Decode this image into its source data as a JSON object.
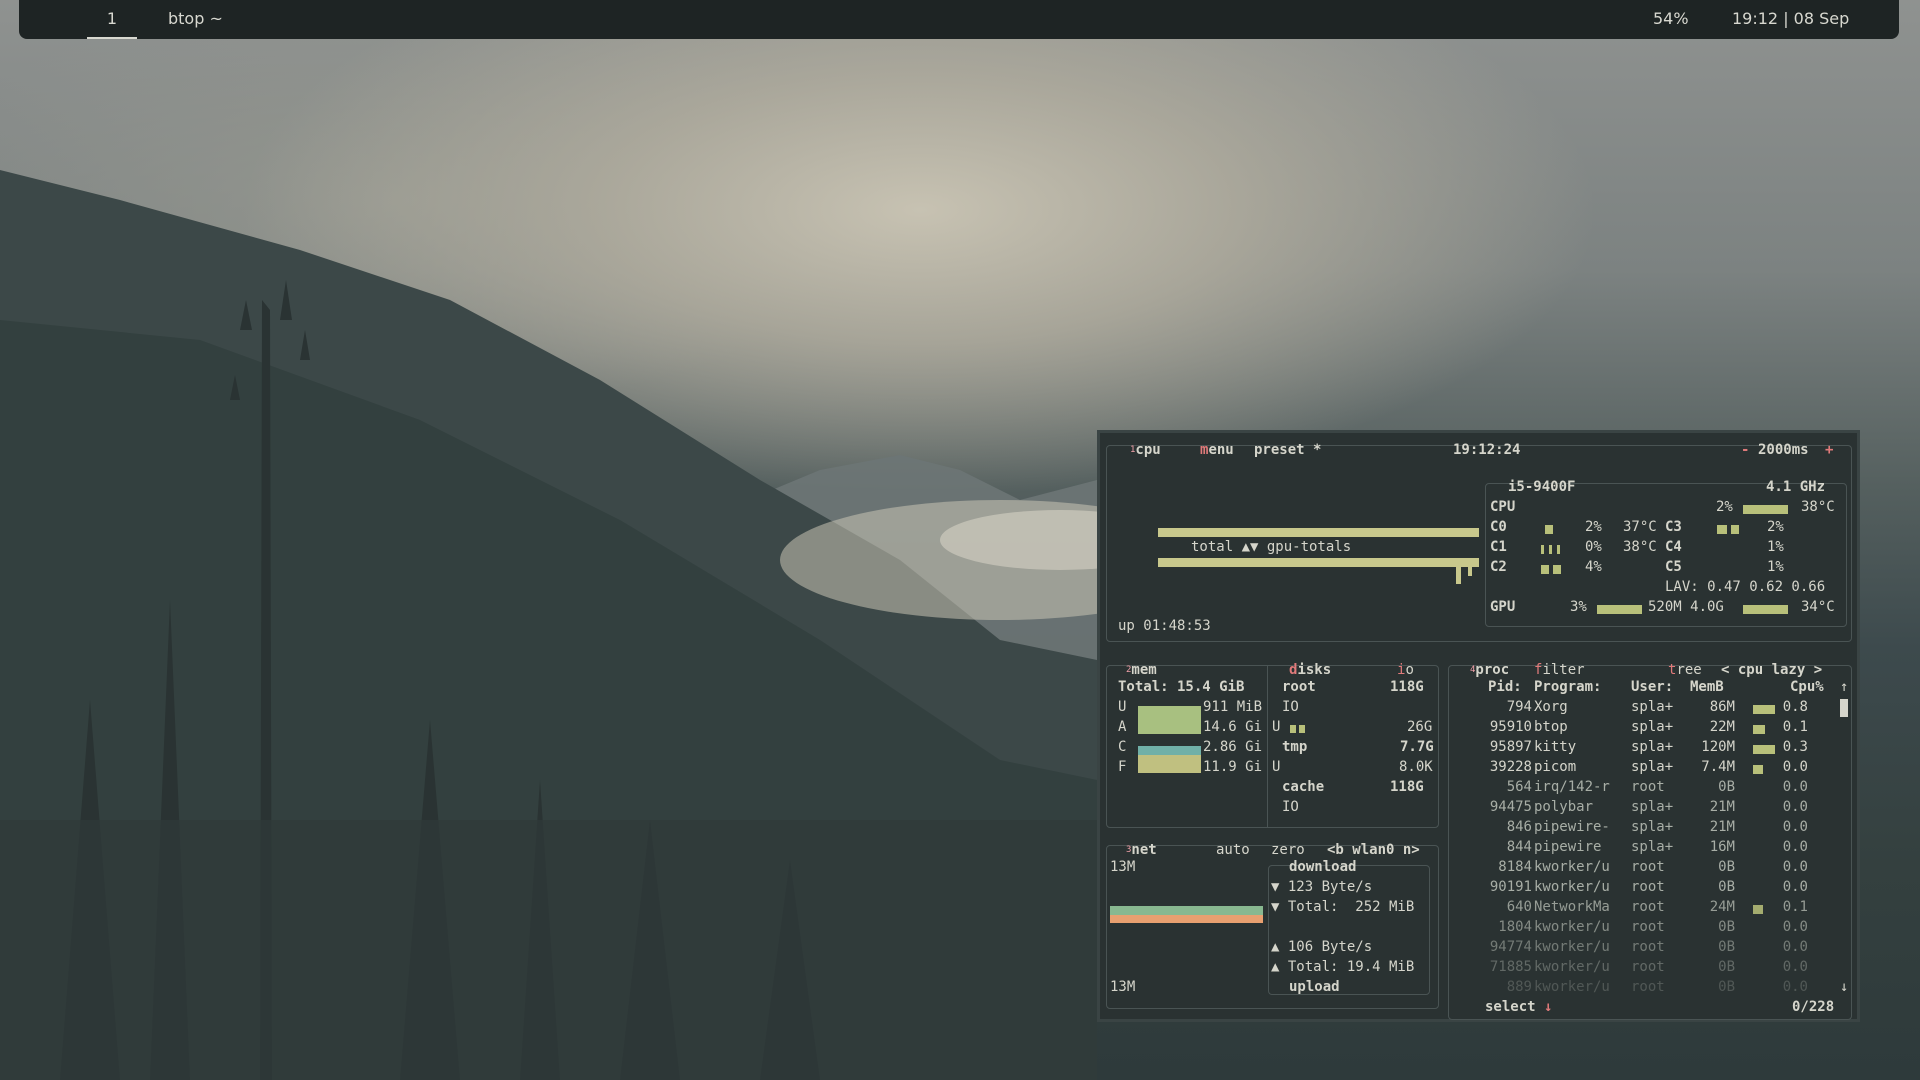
{
  "topbar": {
    "workspace": "1",
    "window_title": "btop ~",
    "battery": "54%",
    "clock": "19:12 | 08 Sep"
  },
  "cpu_box": {
    "num": "1",
    "title": "cpu",
    "menu": "menu",
    "preset": "preset *",
    "time": "19:12:24",
    "interval_minus": "-",
    "interval": "2000ms",
    "interval_plus": "+",
    "graph_label": "total ▲▼ gpu-totals",
    "uptime": "up 01:48:53",
    "model": "i5-9400F",
    "freq": "4.1 GHz",
    "cpu_label": "CPU",
    "cpu_pct": "2%",
    "cpu_temp": "38°C",
    "cores": [
      {
        "name": "C0",
        "pct": "2%",
        "temp": "37°C"
      },
      {
        "name": "C1",
        "pct": "0%",
        "temp": "38°C"
      },
      {
        "name": "C2",
        "pct": "4%",
        "temp": ""
      },
      {
        "name": "C3",
        "pct": "2%",
        "temp": ""
      },
      {
        "name": "C4",
        "pct": "1%",
        "temp": ""
      },
      {
        "name": "C5",
        "pct": "1%",
        "temp": ""
      }
    ],
    "lav": "LAV: 0.47 0.62 0.66",
    "gpu_label": "GPU",
    "gpu_pct": "3%",
    "gpu_mem": "520M 4.0G",
    "gpu_temp": "34°C"
  },
  "mem_box": {
    "num": "2",
    "title": "mem",
    "total": "Total: 15.4 GiB",
    "rows": [
      {
        "label": "U",
        "value": "911 MiB",
        "color": "#a8c080"
      },
      {
        "label": "A",
        "value": "14.6 Gi",
        "color": "#a8c080"
      },
      {
        "label": "C",
        "value": "2.86 Gi",
        "color": "#70b0a8"
      },
      {
        "label": "F",
        "value": "11.9 Gi",
        "color": "#c0c080"
      }
    ],
    "disks_title": "disks",
    "io_label": "io",
    "disks": [
      {
        "name": "root",
        "size": "118G",
        "sub": "IO",
        "u": "",
        "uval": "26G"
      },
      {
        "name": "tmp",
        "size": "7.7G",
        "sub": "",
        "u": "U",
        "uval": "8.0K"
      },
      {
        "name": "cache",
        "size": "118G",
        "sub": "IO",
        "u": "",
        "uval": ""
      }
    ]
  },
  "net_box": {
    "num": "3",
    "title": "net",
    "auto": "auto",
    "zero": "zero",
    "iface": "<b wlan0 n>",
    "scale_top": "13M",
    "scale_bottom": "13M",
    "download": "download",
    "down_rate": "▼ 123 Byte/s",
    "down_total": "▼ Total:  252 MiB",
    "up_rate": "▲ 106 Byte/s",
    "up_total": "▲ Total: 19.4 MiB",
    "upload": "upload"
  },
  "proc_box": {
    "num": "4",
    "title": "proc",
    "filter": "filter",
    "tree": "tree",
    "sort": "< cpu lazy >",
    "headers": {
      "pid": "Pid:",
      "program": "Program:",
      "user": "User:",
      "mem": "MemB",
      "cpu": "Cpu%"
    },
    "rows": [
      {
        "pid": "794",
        "program": "Xorg",
        "user": "spla+",
        "mem": "86M",
        "cpu": "0.8"
      },
      {
        "pid": "95910",
        "program": "btop",
        "user": "spla+",
        "mem": "22M",
        "cpu": "0.1"
      },
      {
        "pid": "95897",
        "program": "kitty",
        "user": "spla+",
        "mem": "120M",
        "cpu": "0.3"
      },
      {
        "pid": "39228",
        "program": "picom",
        "user": "spla+",
        "mem": "7.4M",
        "cpu": "0.0"
      },
      {
        "pid": "564",
        "program": "irq/142-r",
        "user": "root",
        "mem": "0B",
        "cpu": "0.0"
      },
      {
        "pid": "94475",
        "program": "polybar",
        "user": "spla+",
        "mem": "21M",
        "cpu": "0.0"
      },
      {
        "pid": "846",
        "program": "pipewire-",
        "user": "spla+",
        "mem": "21M",
        "cpu": "0.0"
      },
      {
        "pid": "844",
        "program": "pipewire",
        "user": "spla+",
        "mem": "16M",
        "cpu": "0.0"
      },
      {
        "pid": "8184",
        "program": "kworker/u",
        "user": "root",
        "mem": "0B",
        "cpu": "0.0"
      },
      {
        "pid": "90191",
        "program": "kworker/u",
        "user": "root",
        "mem": "0B",
        "cpu": "0.0"
      },
      {
        "pid": "640",
        "program": "NetworkMa",
        "user": "root",
        "mem": "24M",
        "cpu": "0.1"
      },
      {
        "pid": "1804",
        "program": "kworker/u",
        "user": "root",
        "mem": "0B",
        "cpu": "0.0"
      },
      {
        "pid": "94774",
        "program": "kworker/u",
        "user": "root",
        "mem": "0B",
        "cpu": "0.0"
      },
      {
        "pid": "71885",
        "program": "kworker/u",
        "user": "root",
        "mem": "0B",
        "cpu": "0.0"
      },
      {
        "pid": "889",
        "program": "kworker/u",
        "user": "root",
        "mem": "0B",
        "cpu": "0.0"
      }
    ],
    "select": "select",
    "select_arrow": "↓",
    "count": "0/228",
    "scroll_up": "↑",
    "scroll_down": "↓"
  }
}
